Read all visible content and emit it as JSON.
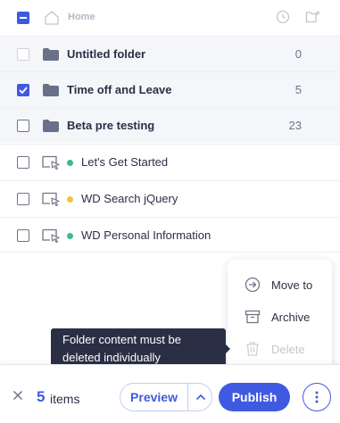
{
  "header": {
    "home_label": "Home"
  },
  "rows": [
    {
      "type": "folder",
      "label": "Untitled folder",
      "count": "0",
      "checked": false
    },
    {
      "type": "folder",
      "label": "Time off and Leave",
      "count": "5",
      "checked": true
    },
    {
      "type": "folder",
      "label": "Beta pre testing",
      "count": "23",
      "checked": false
    },
    {
      "type": "flow",
      "label": "Let's Get Started",
      "status_color": "#43b48f"
    },
    {
      "type": "flow",
      "label": "WD Search jQuery",
      "status_color": "#f0c343"
    },
    {
      "type": "flow",
      "label": "WD Personal Information",
      "status_color": "#43b48f"
    }
  ],
  "menu": {
    "items": [
      {
        "label": "Move to",
        "icon": "move-to-icon"
      },
      {
        "label": "Archive",
        "icon": "archive-icon"
      },
      {
        "label": "Delete",
        "icon": "trash-icon",
        "disabled": true
      }
    ]
  },
  "tooltip": {
    "text_line1": "Folder content must be",
    "text_line2": "deleted individually"
  },
  "bottom_bar": {
    "selected_count": "5",
    "selected_label": "items",
    "preview_label": "Preview",
    "publish_label": "Publish"
  },
  "colors": {
    "accent": "#3f5ae0",
    "dark": "#2b2f45",
    "muted": "#6f7386"
  }
}
